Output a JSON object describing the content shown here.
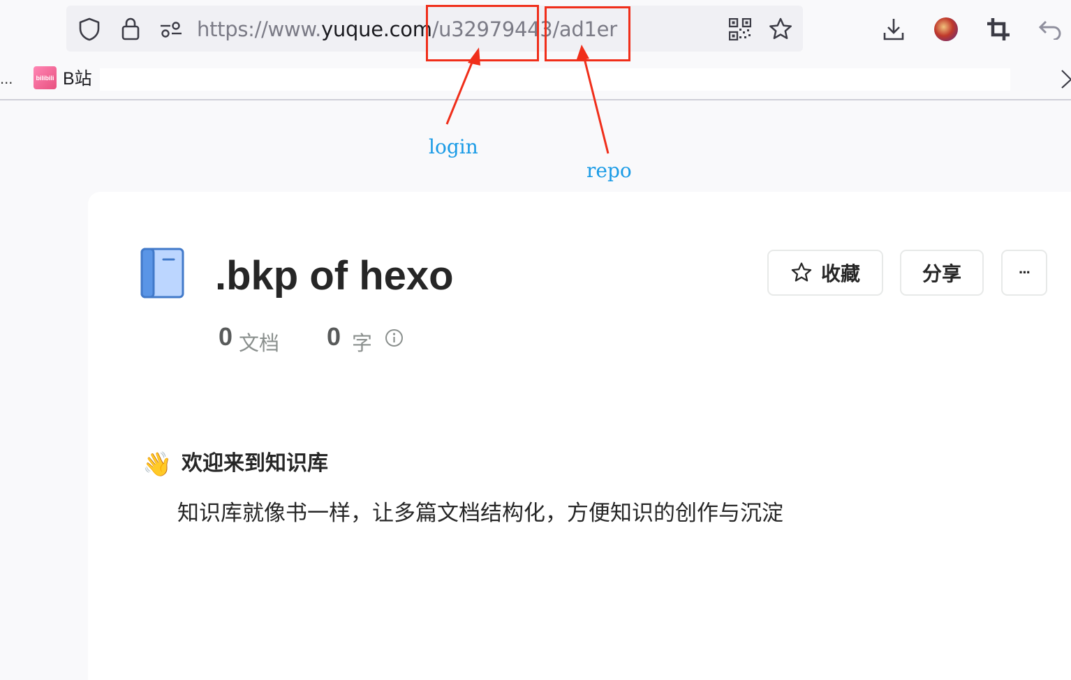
{
  "browser": {
    "url": {
      "prefix": "https://www.",
      "host": "yuque.com",
      "path": "/u32979443/ad1er"
    },
    "bookmarks": {
      "overflow": "...",
      "items": [
        {
          "label": "B站",
          "icon_text": "bilibili"
        }
      ]
    }
  },
  "annotations": {
    "login_label": "login",
    "repo_label": "repo",
    "color": "#f02e1a",
    "label_color": "#1a9be6"
  },
  "repo": {
    "title": ".bkp of hexo",
    "star_button": "收藏",
    "share_button": "分享",
    "more_button": "···",
    "stats": {
      "docs_count": "0",
      "docs_label": "文档",
      "words_count": "0",
      "words_label": "字"
    },
    "welcome": {
      "emoji": "👋",
      "title": "欢迎来到知识库",
      "description": "知识库就像书一样，让多篇文档结构化，方便知识的创作与沉淀"
    },
    "icon_color": "#5a95e6"
  }
}
